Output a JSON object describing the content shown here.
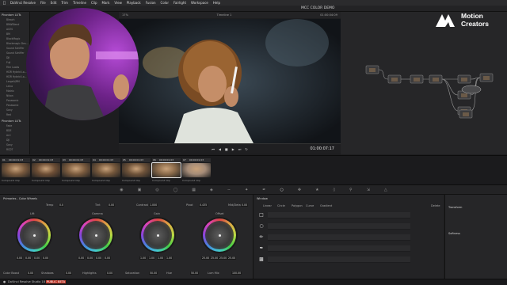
{
  "menubar": {
    "items": [
      "DaVinci Resolve",
      "File",
      "Edit",
      "Trim",
      "Timeline",
      "Clip",
      "Mark",
      "View",
      "Playback",
      "Fusion",
      "Color",
      "Fairlight",
      "Workspace",
      "Help"
    ]
  },
  "viewer_header": {
    "zoom": "17%",
    "timeline": "Timeline 1",
    "timecode": "01:00:04:09"
  },
  "project_title": "MCC COLOR DEMO",
  "left_panel": {
    "tab_top": "Phantom LUTs",
    "items_top": [
      "Bleach",
      "BNWBlend",
      "ACES",
      "BM",
      "BlackMagic",
      "Blackmagic Des...",
      "Sound Schiffer",
      "Sound Schiffer",
      "DJI",
      "Fuji",
      "Film Looks",
      "HDR Hybrid Lo...",
      "HDR Hybrid Lo...",
      "LargeA/RM",
      "Leica",
      "Matrix",
      "Nikon",
      "Panasonic",
      "Panasonic",
      "Sony",
      "Red"
    ],
    "tab_bottom": "Phantom LUTs",
    "items_bottom": [
      "Fade",
      "BDE",
      "Arri",
      "DJI",
      "Sony",
      "RCDT"
    ]
  },
  "transport": {
    "timecode": "01:00:07:17"
  },
  "clips": [
    {
      "num": "01",
      "tc": "00:00:01:03",
      "name": "Compound Clip"
    },
    {
      "num": "02",
      "tc": "00:00:01:03",
      "name": "Compound Clip"
    },
    {
      "num": "03",
      "tc": "00:00:01:03",
      "name": "Compound Clip"
    },
    {
      "num": "04",
      "tc": "00:00:01:03",
      "name": "Compound Clip"
    },
    {
      "num": "05",
      "tc": "00:00:01:03",
      "name": "Compound Clip"
    },
    {
      "num": "06",
      "tc": "00:00:01:03",
      "name": "Compound Clip"
    },
    {
      "num": "07",
      "tc": "00:00:01:03",
      "name": "Compound Clip"
    }
  ],
  "wheels_panel": {
    "title": "Primaries - Color Wheels",
    "params": [
      {
        "label": "Temp",
        "value": "0.0"
      },
      {
        "label": "Tint",
        "value": "0.00"
      },
      {
        "label": "Contrast",
        "value": "1.000"
      },
      {
        "label": "Pivot",
        "value": "0.435"
      },
      {
        "label": "Mid/Detail",
        "value": "0.00"
      }
    ],
    "wheels": [
      {
        "name": "Lift",
        "values": [
          "0.00",
          "0.00",
          "0.00",
          "0.00"
        ]
      },
      {
        "name": "Gamma",
        "values": [
          "0.00",
          "0.00",
          "0.00",
          "0.00"
        ]
      },
      {
        "name": "Gain",
        "values": [
          "1.00",
          "1.00",
          "1.00",
          "1.00"
        ]
      },
      {
        "name": "Offset",
        "values": [
          "25.00",
          "25.00",
          "25.00",
          "25.00"
        ]
      }
    ],
    "bottom": [
      {
        "label": "Color Boost",
        "value": "0.00"
      },
      {
        "label": "Shadows",
        "value": "0.00"
      },
      {
        "label": "Highlights",
        "value": "0.00"
      },
      {
        "label": "Saturation",
        "value": "50.00"
      },
      {
        "label": "Hue",
        "value": "50.00"
      },
      {
        "label": "Lum Mix",
        "value": "100.00"
      }
    ]
  },
  "window_panel": {
    "title": "Window",
    "tabs": [
      "Linear",
      "Circle",
      "Polygon",
      "Curve",
      "Gradient"
    ],
    "right_label": "Delete"
  },
  "transform_panel": {
    "title": "Transform",
    "softness_title": "Softness"
  },
  "footer": {
    "app": "DaVinci Resolve Studio 18",
    "badge": "PUBLIC BETA"
  },
  "logo": {
    "line1": "Motion",
    "line2": "Creators"
  }
}
